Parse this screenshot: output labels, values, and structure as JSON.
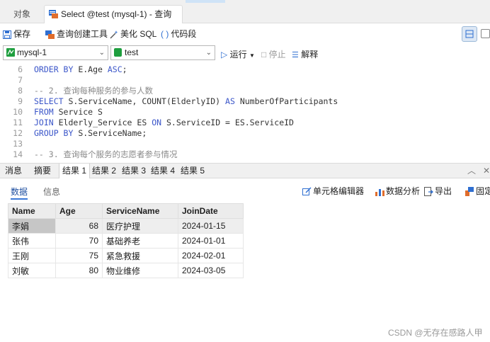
{
  "tabs": {
    "objects": "对象",
    "query": "Select @test (mysql-1) - 查询"
  },
  "toolbar": {
    "save": "保存",
    "query_builder": "查询创建工具",
    "beautify": "美化 SQL",
    "snippet": "代码段"
  },
  "connection": {
    "name": "mysql-1",
    "database": "test",
    "run": "运行",
    "stop": "停止",
    "explain": "解释"
  },
  "editor": {
    "lines": [
      {
        "n": "6",
        "parts": [
          {
            "t": "ORDER BY ",
            "c": "kw"
          },
          {
            "t": "E.Age ",
            "c": "tx"
          },
          {
            "t": "ASC",
            "c": "kw"
          },
          {
            "t": ";",
            "c": "tx"
          }
        ]
      },
      {
        "n": "7",
        "parts": []
      },
      {
        "n": "8",
        "parts": [
          {
            "t": "-- 2. 查询每种服务的参与人数",
            "c": "cm"
          }
        ]
      },
      {
        "n": "9",
        "parts": [
          {
            "t": "SELECT ",
            "c": "kw"
          },
          {
            "t": "S.ServiceName, COUNT(ElderlyID) ",
            "c": "tx"
          },
          {
            "t": "AS ",
            "c": "kw"
          },
          {
            "t": "NumberOfParticipants",
            "c": "tx"
          }
        ]
      },
      {
        "n": "10",
        "parts": [
          {
            "t": "FROM ",
            "c": "kw"
          },
          {
            "t": "Service S",
            "c": "tx"
          }
        ]
      },
      {
        "n": "11",
        "parts": [
          {
            "t": "JOIN ",
            "c": "kw"
          },
          {
            "t": "Elderly_Service ES ",
            "c": "tx"
          },
          {
            "t": "ON ",
            "c": "kw"
          },
          {
            "t": "S.ServiceID = ES.ServiceID",
            "c": "tx"
          }
        ]
      },
      {
        "n": "12",
        "parts": [
          {
            "t": "GROUP BY ",
            "c": "kw"
          },
          {
            "t": "S.ServiceName;",
            "c": "tx"
          }
        ]
      },
      {
        "n": "13",
        "parts": []
      },
      {
        "n": "14",
        "parts": [
          {
            "t": "-- 3. 查询每个服务的志愿者参与情况",
            "c": "cm"
          }
        ]
      }
    ]
  },
  "result_tabs": [
    "消息",
    "摘要",
    "结果 1",
    "结果 2",
    "结果 3",
    "结果 4",
    "结果 5"
  ],
  "result_tab_controls": {
    "collapse": "︿",
    "close": "✕"
  },
  "subtabs": {
    "data": "数据",
    "info": "信息"
  },
  "subtools": {
    "cell_editor": "单元格编辑器",
    "analysis": "数据分析",
    "export": "导出",
    "pin": "固定"
  },
  "grid": {
    "columns": [
      "Name",
      "Age",
      "ServiceName",
      "JoinDate"
    ],
    "rows": [
      [
        "李娟",
        "68",
        "医疗护理",
        "2024-01-15"
      ],
      [
        "张伟",
        "70",
        "基础养老",
        "2024-01-01"
      ],
      [
        "王刚",
        "75",
        "紧急救援",
        "2024-02-01"
      ],
      [
        "刘敏",
        "80",
        "物业维修",
        "2024-03-05"
      ]
    ]
  },
  "watermark": "CSDN @无存在感路人甲"
}
